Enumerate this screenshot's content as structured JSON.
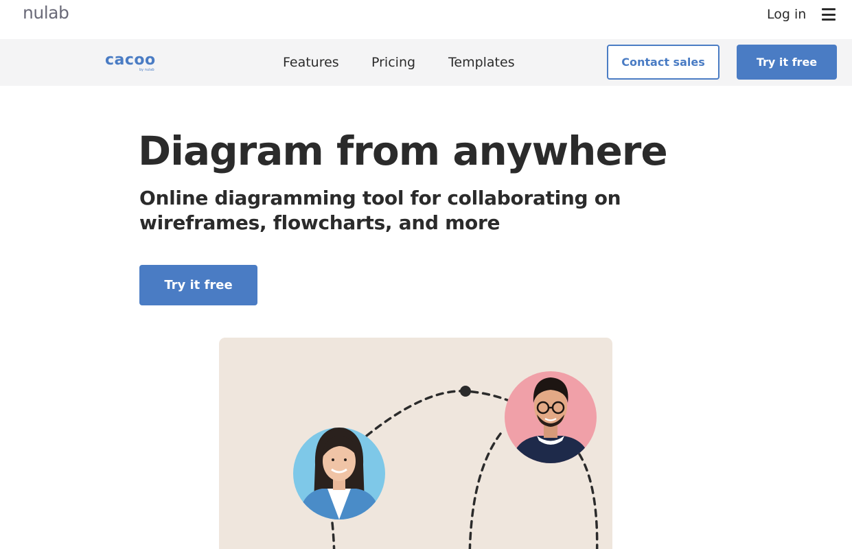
{
  "brand": {
    "nulab_logo": "nulab",
    "cacoo_logo": "cacoo",
    "cacoo_byline": "by nulab"
  },
  "topbar": {
    "login_label": "Log in",
    "menu_icon": "hamburger-menu-icon"
  },
  "nav": {
    "links": [
      "Features",
      "Pricing",
      "Templates"
    ],
    "contact_sales": "Contact sales",
    "try_free": "Try it free"
  },
  "hero": {
    "title": "Diagram from anywhere",
    "subtitle": "Online diagramming tool for collaborating on wireframes, flowcharts, and more",
    "cta": "Try it free"
  },
  "illustration": {
    "avatars": [
      "woman-avatar",
      "man-avatar"
    ],
    "colors": {
      "panel": "#efe6dd",
      "woman_bg": "#7ec8e8",
      "man_bg": "#f0a0a8",
      "line": "#2b2b2b"
    }
  },
  "colors": {
    "accent": "#4a7cc4",
    "nav_bg": "#f4f4f5",
    "text": "#2b2b2b"
  }
}
